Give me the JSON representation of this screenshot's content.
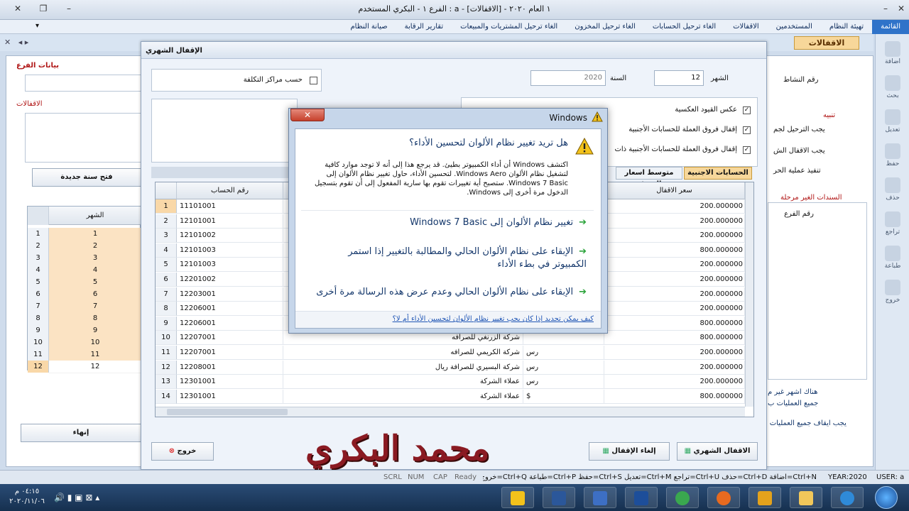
{
  "window": {
    "title": "الفرع ١ - البكري  المستخدم : a - ١  العام ٢٠٢٠ - [الاقفالات]"
  },
  "menu": {
    "items": [
      "القائمة",
      "تهيئة النظام",
      "المستخدمين",
      "الاقفالات",
      "الغاء ترحيل الحسابات",
      "الغاء ترحيل المخزون",
      "الغاء ترحيل المشتريات والمبيعات",
      "تقارير الرقابة",
      "صيانة النظام"
    ],
    "active": "القائمة"
  },
  "tab": {
    "label": "الاقفالات"
  },
  "toolbar": {
    "items": [
      {
        "label": "اضافة",
        "icon": "add-icon"
      },
      {
        "label": "بحث",
        "icon": "search-icon"
      },
      {
        "label": "تعديل",
        "icon": "edit-icon"
      },
      {
        "label": "حفظ",
        "icon": "save-icon"
      },
      {
        "label": "حذف",
        "icon": "delete-icon"
      },
      {
        "label": "تراجع",
        "icon": "undo-icon"
      },
      {
        "label": "طباعة",
        "icon": "print-icon"
      },
      {
        "label": "خروج",
        "icon": "exit-icon"
      }
    ]
  },
  "bgform": {
    "branch_data": "بيانات الفرع",
    "closings": "الاقفالات",
    "new_year_button": "فتح سنة جديدة",
    "month_header": "الشهر",
    "months": [
      "1",
      "2",
      "3",
      "4",
      "5",
      "6",
      "7",
      "8",
      "9",
      "10",
      "11",
      "12"
    ],
    "finish_button": "إنهاء",
    "activity_no": "رقم النشاط",
    "warning": "تنبيه",
    "warn1": "يجب الترحيل لجم",
    "warn2": "يجب الاقفال الش",
    "warn3": "تنفيذ عملية الحر",
    "unposted": "السندات الغير مرحلة",
    "branch_no": "رقم الفرع",
    "note1": "هناك اشهر غير م",
    "note2": "جميع العمليات ب",
    "note3": "يجب ايقاف جميع العمليات عل"
  },
  "dialog": {
    "title": "الإقفال الشهري",
    "month_label": "الشهر",
    "month_value": "12",
    "year_label": "السنة",
    "year_value": "2020",
    "cost_centers": "حسب مراكز التكلفة",
    "reverse_entries": "عكس القيود العكسية",
    "close_diff_foreign": "إقفال فروق العملة للحسابات الأجنبية",
    "close_diff_foreign2": "إقفال فروق العملة للحسابات الأجنبية ذات",
    "tab_foreign": "الحسابات الاجنبية",
    "tab_avg": "متوسط اسعار الصرف",
    "col_account": "رقم الحساب",
    "col_rate": "سعر الاقفال",
    "monthly_close_button": "الاقفال الشهري",
    "cancel_close_button": "إلغاء الإقفال",
    "exit_button": "خروج",
    "rows": [
      {
        "n": "1",
        "acc": "11101001",
        "name": "",
        "cur": "",
        "rate": "200.000000"
      },
      {
        "n": "2",
        "acc": "12101001",
        "name": "",
        "cur": "",
        "rate": "200.000000"
      },
      {
        "n": "3",
        "acc": "12101002",
        "name": "",
        "cur": "",
        "rate": "200.000000"
      },
      {
        "n": "4",
        "acc": "12101003",
        "name": "",
        "cur": "",
        "rate": "800.000000"
      },
      {
        "n": "5",
        "acc": "12101003",
        "name": "",
        "cur": "",
        "rate": "200.000000"
      },
      {
        "n": "6",
        "acc": "12201002",
        "name": "",
        "cur": "",
        "rate": "200.000000"
      },
      {
        "n": "7",
        "acc": "12203001",
        "name": "",
        "cur": "",
        "rate": "200.000000"
      },
      {
        "n": "8",
        "acc": "12206001",
        "name": "",
        "cur": "",
        "rate": "200.000000"
      },
      {
        "n": "9",
        "acc": "12206001",
        "name": "",
        "cur": "",
        "rate": "800.000000"
      },
      {
        "n": "10",
        "acc": "12207001",
        "name": "شركة الزرنغي للصرافه",
        "cur": "",
        "rate": "800.000000"
      },
      {
        "n": "11",
        "acc": "12207001",
        "name": "شركة الكريمي للصرافه",
        "cur": "رس",
        "rate": "200.000000"
      },
      {
        "n": "12",
        "acc": "12208001",
        "name": "شركة البسيري للصرافة ريال",
        "cur": "رس",
        "rate": "200.000000"
      },
      {
        "n": "13",
        "acc": "12301001",
        "name": "عملاء الشركة",
        "cur": "رس",
        "rate": "200.000000"
      },
      {
        "n": "14",
        "acc": "12301001",
        "name": "عملاء الشركة",
        "cur": "$",
        "rate": "800.000000"
      }
    ]
  },
  "popup": {
    "title": "Windows",
    "heading": "هل تريد تغيير نظام الألوان لتحسين الأداء؟",
    "message": "اكتشف Windows أن أداء الكمبيوتر بطيئ. قد يرجع هذا إلى أنه لا توجد موارد كافية لتشغيل نظام الألوان Windows Aero. لتحسين الأداء، حاول تغيير نظام الألوان إلى Windows 7 Basic. ستصبح أية تغييرات تقوم بها سارية المفعول إلى أن تقوم بتسجيل الدخول مرة أخرى إلى Windows.",
    "option1": "تغيير نظام الألوان إلى Windows 7 Basic",
    "option2": "الإبقاء على نظام الألوان الحالي والمطالبة بالتغيير إذا استمر الكمبيوتر في بطء الأداء",
    "option3": "الإبقاء على نظام الألوان الحالي وعدم عرض هذه الرسالة مرة أخرى",
    "link": "كيف يمكن تحديد إذا كان يجب تغيير نظام الألوان لتحسين الأداء أم لا؟",
    "close": "✕"
  },
  "status": {
    "shortcuts": "Ctrl+N=اضافة Ctrl+D=حذف Ctrl+U=تراجع Ctrl+M=تعديل Ctrl+S=حفظ Ctrl+P=طباعة Ctrl+Q=خروج",
    "ready": "Ready",
    "caps": "CAP",
    "num": "NUM",
    "scrl": "SCRL",
    "year": "YEAR:2020",
    "user": "USER: a"
  },
  "taskbar": {
    "time": "٠٤:١٥ م",
    "date": "٢٠٢٠/١١/٠٦"
  },
  "watermark": "محمد البكري"
}
